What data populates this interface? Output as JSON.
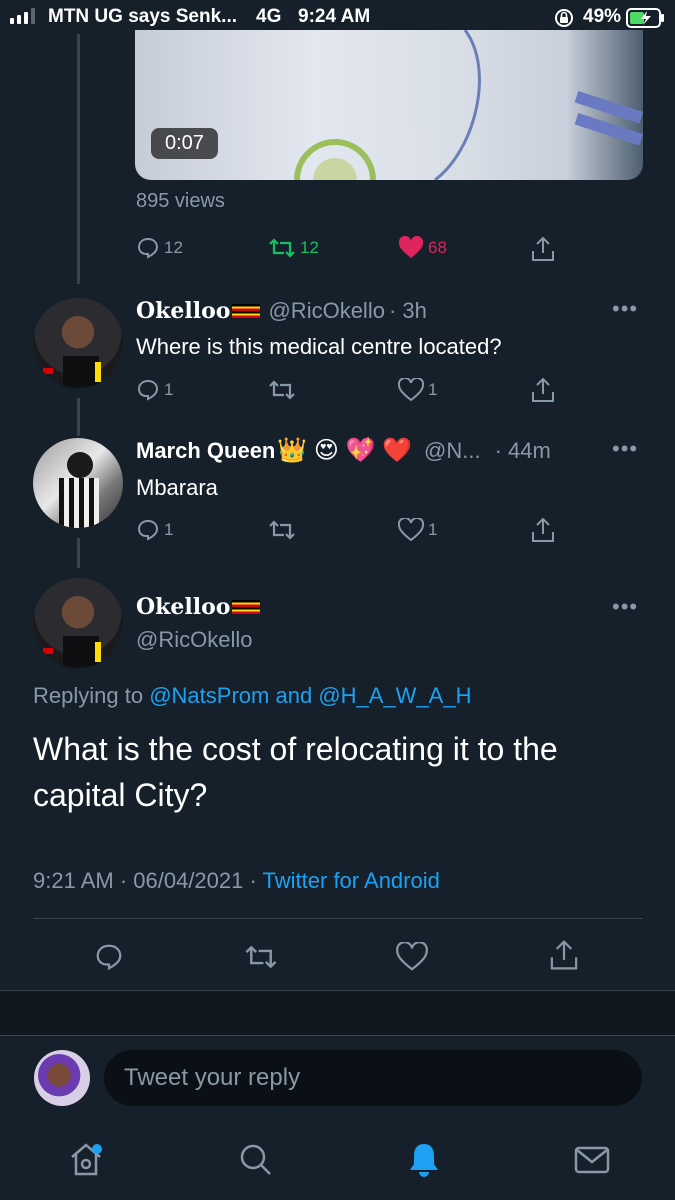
{
  "status": {
    "carrier": "MTN UG says Senk...",
    "network": "4G",
    "time": "9:24 AM",
    "battery": "49%"
  },
  "video": {
    "duration": "0:07",
    "views": "895 views"
  },
  "parent_actions": {
    "replies": "12",
    "retweets": "12",
    "likes": "68"
  },
  "replies": [
    {
      "name": "Okelloo",
      "handle": "@RicOkello",
      "time": "· 3h",
      "text": "Where is this medical centre located?",
      "replies": "1",
      "likes": "1"
    },
    {
      "name": "March Queen",
      "emojis": "👑 😍 💖 ❤️",
      "handle": "@N...",
      "time": "· 44m",
      "text": "Mbarara",
      "replies": "1",
      "likes": "1"
    }
  ],
  "focused": {
    "name": "Okelloo",
    "handle": "@RicOkello",
    "replying_prefix": "Replying to",
    "replying_to_1": "@NatsProm",
    "replying_and": "and",
    "replying_to_2": "@H_A_W_A_H",
    "text": "What is the cost of relocating it to the capital City?",
    "timestamp": "9:21 AM · 06/04/2021 ·",
    "source": "Twitter for Android"
  },
  "compose": {
    "placeholder": "Tweet your reply"
  },
  "colors": {
    "background": "#15202b",
    "accent": "#1da1f2",
    "like": "#e0245e",
    "retweet": "#17bf63",
    "muted": "#8899a6"
  }
}
